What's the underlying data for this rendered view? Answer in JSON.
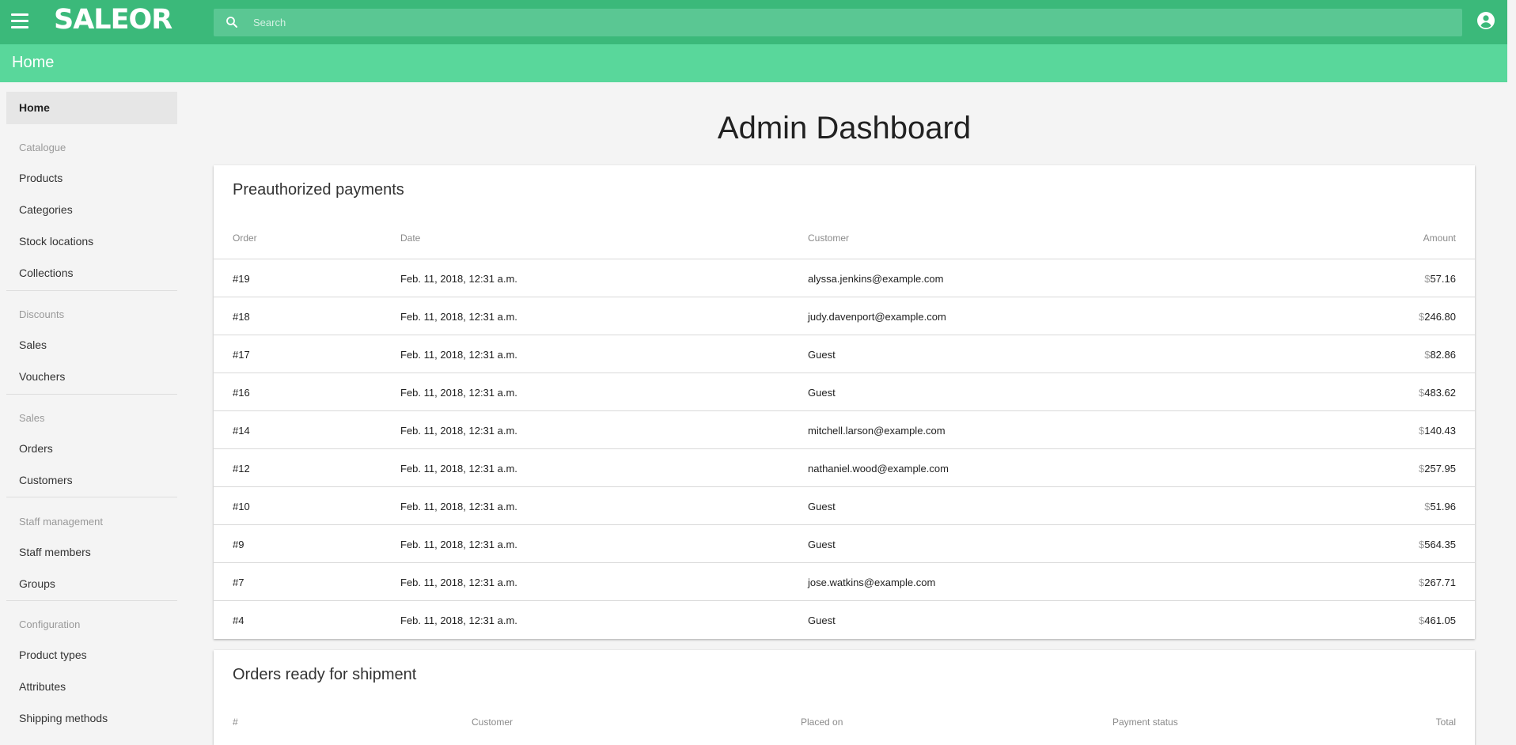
{
  "header": {
    "logo": "SALEOR",
    "search_placeholder": "Search"
  },
  "page": {
    "title": "Home",
    "heading": "Admin Dashboard"
  },
  "sidebar": {
    "home": "Home",
    "sections": [
      {
        "label": "Catalogue",
        "items": [
          "Products",
          "Categories",
          "Stock locations",
          "Collections"
        ]
      },
      {
        "label": "Discounts",
        "items": [
          "Sales",
          "Vouchers"
        ]
      },
      {
        "label": "Sales",
        "items": [
          "Orders",
          "Customers"
        ]
      },
      {
        "label": "Staff management",
        "items": [
          "Staff members",
          "Groups"
        ]
      },
      {
        "label": "Configuration",
        "items": [
          "Product types",
          "Attributes",
          "Shipping methods"
        ]
      }
    ]
  },
  "preauth": {
    "title": "Preauthorized payments",
    "columns": [
      "Order",
      "Date",
      "Customer",
      "Amount"
    ],
    "rows": [
      {
        "order": "#19",
        "date": "Feb. 11, 2018, 12:31 a.m.",
        "customer": "alyssa.jenkins@example.com",
        "currency": "$",
        "amount": "57.16"
      },
      {
        "order": "#18",
        "date": "Feb. 11, 2018, 12:31 a.m.",
        "customer": "judy.davenport@example.com",
        "currency": "$",
        "amount": "246.80"
      },
      {
        "order": "#17",
        "date": "Feb. 11, 2018, 12:31 a.m.",
        "customer": "Guest",
        "currency": "$",
        "amount": "82.86"
      },
      {
        "order": "#16",
        "date": "Feb. 11, 2018, 12:31 a.m.",
        "customer": "Guest",
        "currency": "$",
        "amount": "483.62"
      },
      {
        "order": "#14",
        "date": "Feb. 11, 2018, 12:31 a.m.",
        "customer": "mitchell.larson@example.com",
        "currency": "$",
        "amount": "140.43"
      },
      {
        "order": "#12",
        "date": "Feb. 11, 2018, 12:31 a.m.",
        "customer": "nathaniel.wood@example.com",
        "currency": "$",
        "amount": "257.95"
      },
      {
        "order": "#10",
        "date": "Feb. 11, 2018, 12:31 a.m.",
        "customer": "Guest",
        "currency": "$",
        "amount": "51.96"
      },
      {
        "order": "#9",
        "date": "Feb. 11, 2018, 12:31 a.m.",
        "customer": "Guest",
        "currency": "$",
        "amount": "564.35"
      },
      {
        "order": "#7",
        "date": "Feb. 11, 2018, 12:31 a.m.",
        "customer": "jose.watkins@example.com",
        "currency": "$",
        "amount": "267.71"
      },
      {
        "order": "#4",
        "date": "Feb. 11, 2018, 12:31 a.m.",
        "customer": "Guest",
        "currency": "$",
        "amount": "461.05"
      }
    ]
  },
  "shipment": {
    "title": "Orders ready for shipment",
    "columns": [
      "#",
      "Customer",
      "Placed on",
      "Payment status",
      "Total"
    ]
  },
  "colors": {
    "topbar": "#3bb97a",
    "subbar": "#59d79b"
  },
  "icons": {
    "menu": "menu-icon",
    "search": "search-icon",
    "account": "account-circle-icon"
  }
}
